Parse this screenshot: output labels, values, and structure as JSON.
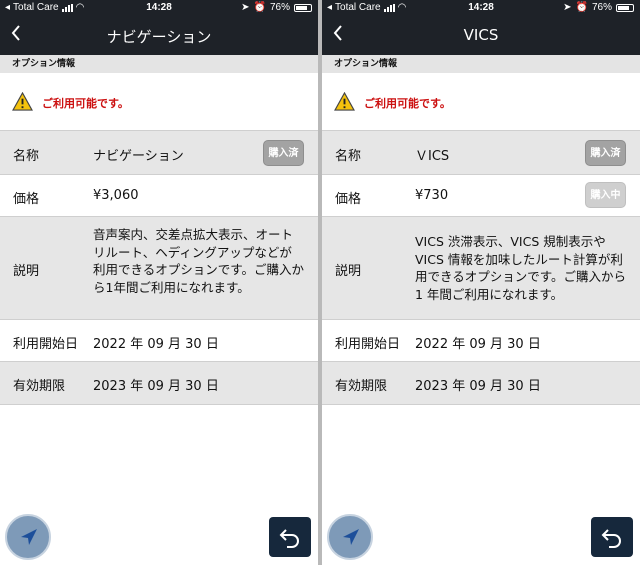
{
  "status_bar": {
    "carrier": "Total Care",
    "time": "14:28",
    "battery": "76%"
  },
  "section_header": "オプション情報",
  "notice_text": "ご利用可能です。",
  "labels": {
    "name": "名称",
    "price": "価格",
    "description": "説明",
    "start_date": "利用開始日",
    "expiry": "有効期限"
  },
  "screens": [
    {
      "title": "ナビゲーション",
      "name": "ナビゲーション",
      "price": "¥3,060",
      "description": "音声案内、交差点拡大表示、オートリルート、ヘディングアップなどが利用できるオプションです。ご購入から1年間ご利用になれます。",
      "start_date": "2022 年 09 月 30 日",
      "expiry": "2023 年 09 月 30 日",
      "badges": [
        "購入済"
      ]
    },
    {
      "title": "VICS",
      "name": "ＶICS",
      "price": "¥730",
      "description": "VICS 渋滞表示、VICS 規制表示やVICS 情報を加味したルート計算が利用できるオプションです。ご購入から 1 年間ご利用になれます。",
      "start_date": "2022 年 09 月 30 日",
      "expiry": "2023 年 09 月 30 日",
      "badges": [
        "購入済",
        "購入中"
      ]
    }
  ],
  "icons": {
    "back": "chevron-left-icon",
    "warning": "warning-icon",
    "compass": "navigation-arrow-icon",
    "return": "return-arrow-icon"
  },
  "colors": {
    "header": "#1e2228",
    "notice": "#cc1010",
    "badge": "#a3a3a3"
  }
}
